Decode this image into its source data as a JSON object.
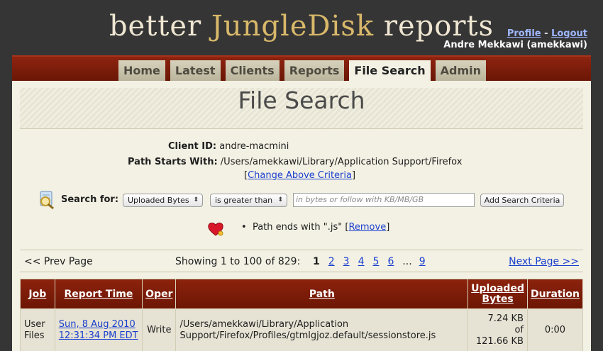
{
  "header": {
    "title_prefix": "better ",
    "title_brand": "JungleDisk",
    "title_suffix": " reports",
    "profile_link": "Profile",
    "separator": "-",
    "logout_link": "Logout",
    "user": "Andre Mekkawi (amekkawi)"
  },
  "nav": {
    "tabs": [
      {
        "label": "Home"
      },
      {
        "label": "Latest"
      },
      {
        "label": "Clients"
      },
      {
        "label": "Reports"
      },
      {
        "label": "File Search"
      },
      {
        "label": "Admin"
      }
    ],
    "active": "File Search"
  },
  "page": {
    "title": "File Search"
  },
  "criteria": {
    "client_label": "Client ID:",
    "client_value": "andre-macmini",
    "path_label": "Path Starts With:",
    "path_value": "/Users/amekkawi/Library/Application Support/Firefox",
    "change_open": "[",
    "change_link": "Change Above Criteria",
    "change_close": "]"
  },
  "search": {
    "label": "Search for:",
    "field_select": "Uploaded Bytes",
    "op_select": "is greater than",
    "input_placeholder": "in bytes or follow with KB/MB/GB",
    "add_button": "Add Search Criteria",
    "icons": {
      "search": "magnifier-search-icon",
      "criteria": "heart-icon"
    }
  },
  "active_criteria": [
    {
      "bullet": "•",
      "text": "Path ends with \".js\"",
      "open": "[",
      "remove": "Remove",
      "close": "]"
    }
  ],
  "pager": {
    "prev": "<< Prev Page",
    "showing": "Showing 1 to 100 of 829:",
    "pages": [
      "1",
      "2",
      "3",
      "4",
      "5",
      "6"
    ],
    "ellipsis": "...",
    "last": "9",
    "next": "Next Page >>"
  },
  "table": {
    "headers": [
      "Job",
      "Report Time",
      "Oper",
      "Path",
      "Uploaded Bytes",
      "Duration"
    ],
    "rows": [
      {
        "job": "User Files",
        "time_line1": "Sun, 8 Aug 2010",
        "time_line2": "12:31:34 PM EDT",
        "oper": "Write",
        "path": "/Users/amekkawi/Library/Application Support/Firefox/Profiles/gtmlgjoz.default/sessionstore.js",
        "uploaded_line1": "7.24 KB",
        "uploaded_line2": "of",
        "uploaded_line3": "121.66 KB",
        "duration": "0:00"
      }
    ]
  },
  "colors": {
    "background": "#353535",
    "nav_red": "#8e2410",
    "panel": "#f3f1e4",
    "link": "#1a3fcf",
    "brand_gold": "#d8b86a"
  }
}
